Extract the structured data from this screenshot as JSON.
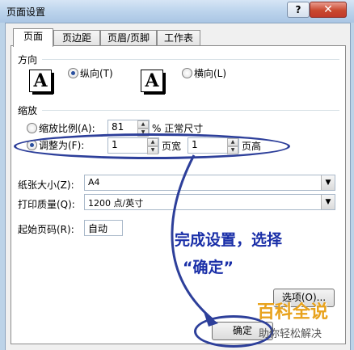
{
  "window": {
    "title": "页面设置",
    "help_label": "?",
    "close_label": "✕"
  },
  "tabs": [
    {
      "label": "页面",
      "active": true
    },
    {
      "label": "页边距",
      "active": false
    },
    {
      "label": "页眉/页脚",
      "active": false
    },
    {
      "label": "工作表",
      "active": false
    }
  ],
  "orientation": {
    "section_label": "方向",
    "icon_glyph": "A",
    "portrait_label": "纵向(T)",
    "landscape_label": "横向(L)",
    "selected": "portrait"
  },
  "scaling": {
    "section_label": "缩放",
    "adjust_label": "缩放比例(A):",
    "adjust_value": "81",
    "adjust_suffix": "% 正常尺寸",
    "fit_label": "调整为(F):",
    "fit_wide_value": "1",
    "fit_wide_suffix": "页宽",
    "fit_tall_value": "1",
    "fit_tall_suffix": "页高",
    "selected": "fit"
  },
  "paper_size": {
    "label": "纸张大小(Z):",
    "value": "A4"
  },
  "print_quality": {
    "label": "打印质量(Q):",
    "value": "1200 点/英寸"
  },
  "first_page": {
    "label": "起始页码(R):",
    "value": "自动"
  },
  "buttons": {
    "options": "选项(O)...",
    "ok": "确定"
  },
  "annotation": {
    "line1": "完成设置，选择",
    "line2": "“确定”"
  },
  "watermark": {
    "main": "百科全说",
    "sub": "助你轻松解决"
  },
  "colors": {
    "annotation": "#1a2fa8",
    "watermark": "#e8a21c"
  }
}
